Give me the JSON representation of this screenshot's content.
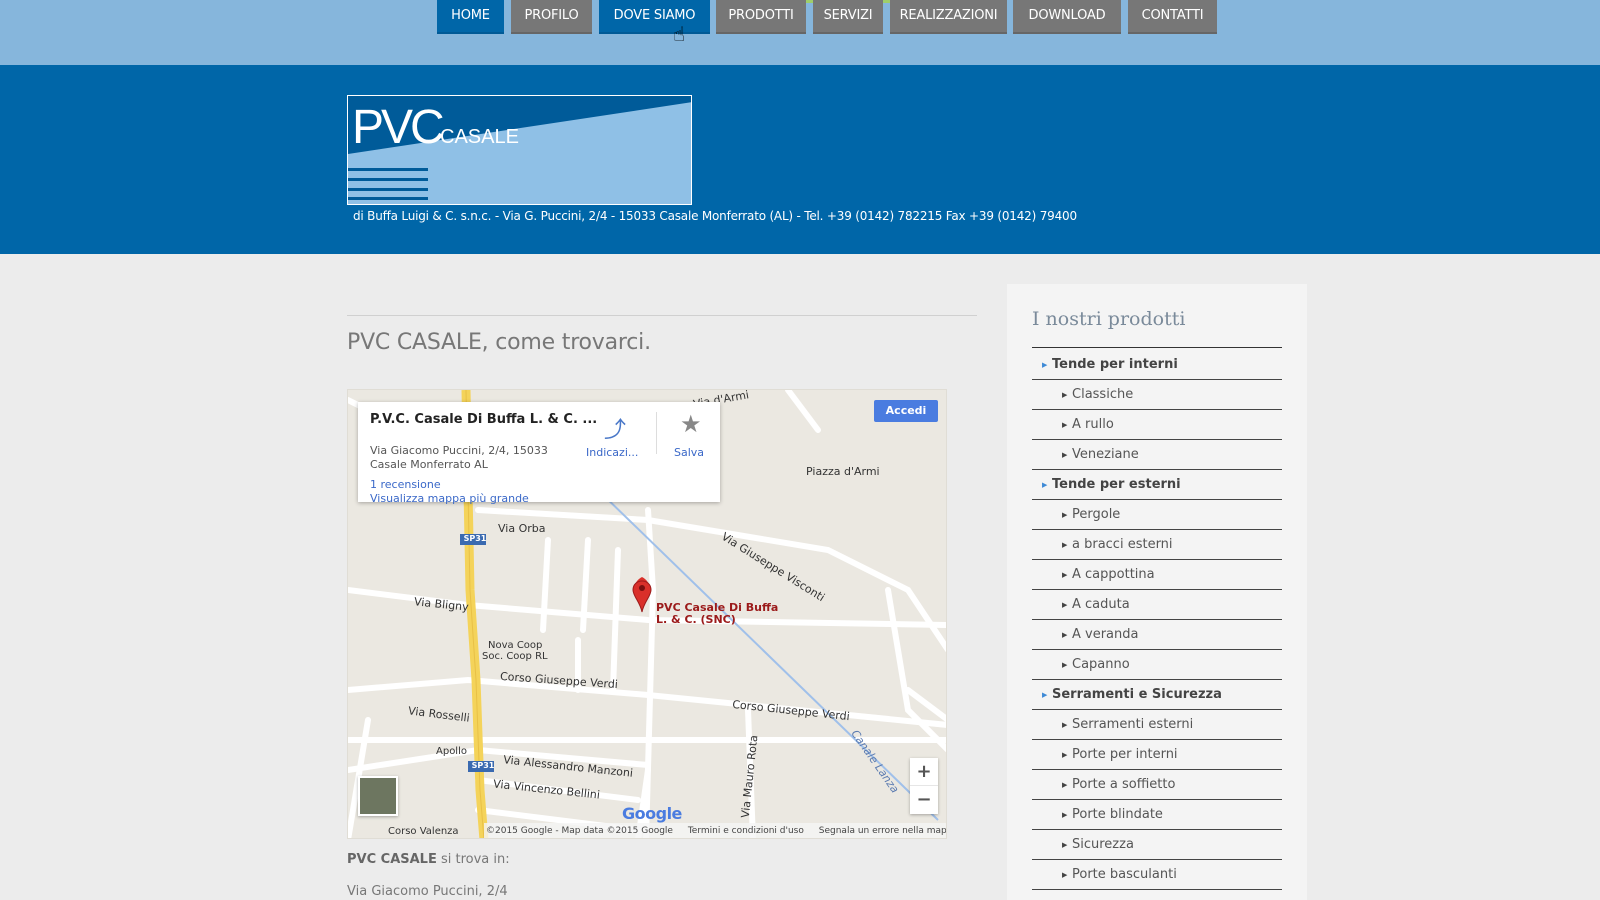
{
  "nav": {
    "items": [
      {
        "label": "HOME",
        "active": true
      },
      {
        "label": "PROFILO",
        "active": false
      },
      {
        "label": "DOVE SIAMO",
        "active": true
      },
      {
        "label": "PRODOTTI",
        "active": false
      },
      {
        "label": "SERVIZI",
        "active": false
      },
      {
        "label": "REALIZZAZIONI",
        "active": false
      },
      {
        "label": "DOWNLOAD",
        "active": false
      },
      {
        "label": "CONTATTI",
        "active": false
      }
    ]
  },
  "header": {
    "logo_text": "PVC",
    "logo_subtext": "CASALE",
    "address": "di Buffa Luigi & C. s.n.c. - Via G. Puccini, 2/4 - 15033 Casale Monferrato (AL) - Tel. +39 (0142) 782215   Fax +39 (0142) 79400"
  },
  "main": {
    "title": "PVC CASALE, come trovarci.",
    "location_intro_bold": "PVC CASALE",
    "location_intro_rest": " si trova in:",
    "street": "Via Giacomo Puccini, 2/4"
  },
  "map": {
    "info_name": "P.V.C. Casale Di Buffa L. & C. ...",
    "info_address_line1": "Via Giacomo Puccini, 2/4, 15033",
    "info_address_line2": "Casale Monferrato AL",
    "info_directions": "Indicazi...",
    "info_save": "Salva",
    "info_reviews": "1 recensione",
    "info_bigger_map": "Visualizza mappa più grande",
    "signin": "Accedi",
    "pin_label_1": "PVC Casale Di Buffa",
    "pin_label_2": "L. & C. (SNC)",
    "labels": {
      "piazza": "Piazza d'Armi",
      "via_orba": "Via Orba",
      "via_visconti": "Via Giuseppe Visconti",
      "via_bligny": "Via Bligny",
      "nova_coop_1": "Nova Coop",
      "nova_coop_2": "Soc. Coop RL",
      "corso_verdi_1": "Corso Giuseppe Verdi",
      "corso_verdi_2": "Corso Giuseppe Verdi",
      "via_rosselli": "Via Rosselli",
      "apollo": "Apollo",
      "via_manzoni": "Via Alessandro Manzoni",
      "via_bellini": "Via Vincenzo Bellini",
      "via_rota": "Via Mauro Rota",
      "canale": "Canale Lanza",
      "corso_valenza": "Corso Valenza",
      "sp31": "SP31",
      "via_armi": "Via d'Armi"
    },
    "zoom_in": "+",
    "zoom_out": "−",
    "google": "Google",
    "attrib_copyright": "©2015 Google - Map data ©2015 Google",
    "attrib_terms": "Termini e condizioni d'uso",
    "attrib_report": "Segnala un errore nella mappa"
  },
  "sidebar": {
    "title": "I nostri prodotti",
    "items": [
      {
        "label": "Tende per interni",
        "level": "cat"
      },
      {
        "label": "Classiche",
        "level": "sub"
      },
      {
        "label": "A rullo",
        "level": "sub"
      },
      {
        "label": "Veneziane",
        "level": "sub"
      },
      {
        "label": "Tende per esterni",
        "level": "cat"
      },
      {
        "label": "Pergole",
        "level": "sub"
      },
      {
        "label": "a bracci esterni",
        "level": "sub"
      },
      {
        "label": "A cappottina",
        "level": "sub"
      },
      {
        "label": "A caduta",
        "level": "sub"
      },
      {
        "label": "A veranda",
        "level": "sub"
      },
      {
        "label": "Capanno",
        "level": "sub"
      },
      {
        "label": "Serramenti e Sicurezza",
        "level": "cat"
      },
      {
        "label": "Serramenti esterni",
        "level": "sub"
      },
      {
        "label": "Porte per interni",
        "level": "sub"
      },
      {
        "label": "Porte a soffietto",
        "level": "sub"
      },
      {
        "label": "Porte blindate",
        "level": "sub"
      },
      {
        "label": "Sicurezza",
        "level": "sub"
      },
      {
        "label": "Porte basculanti",
        "level": "sub"
      }
    ]
  },
  "colors": {
    "header_blue": "#0066a8",
    "nav_band": "#86b6dc",
    "nav_inactive": "#777777",
    "pin_red": "#d9302a"
  }
}
